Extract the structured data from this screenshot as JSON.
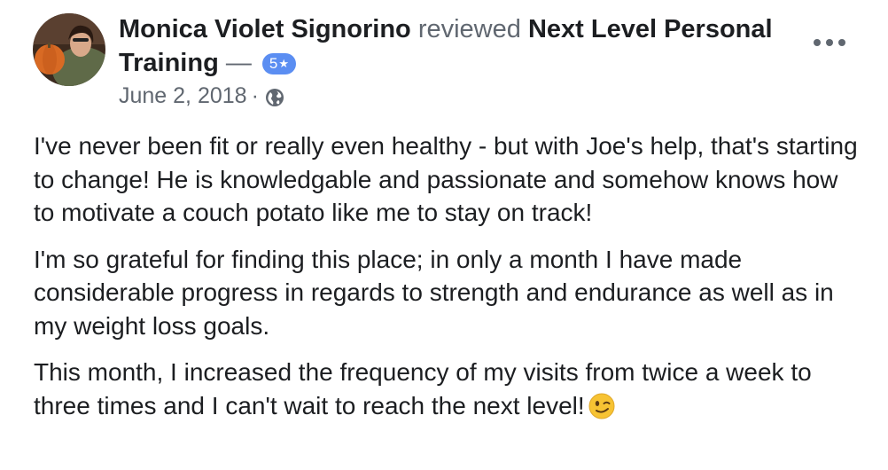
{
  "review": {
    "author": "Monica Violet Signorino",
    "verb": "reviewed",
    "page": "Next Level Personal Training",
    "dash": "—",
    "rating": "5",
    "rating_icon": "star-icon",
    "date": "June 2, 2018",
    "separator": "·",
    "privacy_icon": "globe-icon",
    "menu_icon": "more-options-icon",
    "paragraphs": [
      "I've never been fit or really even healthy  - but with Joe's help, that's starting to change! He is knowledgable and passionate and somehow knows how to motivate a couch potato like me to stay on track!",
      "I'm so grateful for finding this place; in only a month I have made considerable progress in regards to strength and endurance as well as in my weight loss goals.",
      "This month, I increased the frequency of my visits from twice a week to three times and I can't wait to reach the next level!"
    ],
    "end_emoji": "winking-face-emoji"
  },
  "colors": {
    "badge": "#5b8ef2",
    "secondary_text": "#606770",
    "primary_text": "#1c1e21"
  }
}
